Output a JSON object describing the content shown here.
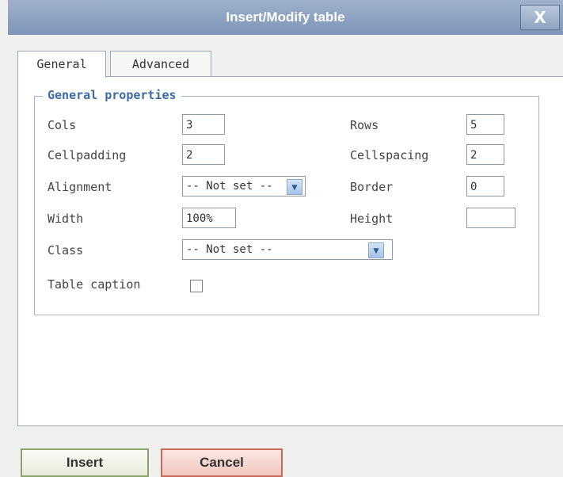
{
  "dialog": {
    "title": "Insert/Modify table",
    "close_label": "X"
  },
  "tabs": [
    {
      "label": "General"
    },
    {
      "label": "Advanced"
    }
  ],
  "general_properties": {
    "legend": "General properties",
    "fields": {
      "cols": {
        "label": "Cols",
        "value": "3"
      },
      "rows": {
        "label": "Rows",
        "value": "5"
      },
      "cellpadding": {
        "label": "Cellpadding",
        "value": "2"
      },
      "cellspacing": {
        "label": "Cellspacing",
        "value": "2"
      },
      "alignment": {
        "label": "Alignment",
        "value": "-- Not set --"
      },
      "border": {
        "label": "Border",
        "value": "0"
      },
      "width": {
        "label": "Width",
        "value": "100%"
      },
      "height": {
        "label": "Height",
        "value": ""
      },
      "class": {
        "label": "Class",
        "value": "-- Not set --"
      },
      "table_caption": {
        "label": "Table caption",
        "checked": false
      }
    }
  },
  "buttons": {
    "insert": "Insert",
    "cancel": "Cancel"
  },
  "icons": {
    "dropdown": "chevron-down-icon",
    "close": "close-icon"
  }
}
